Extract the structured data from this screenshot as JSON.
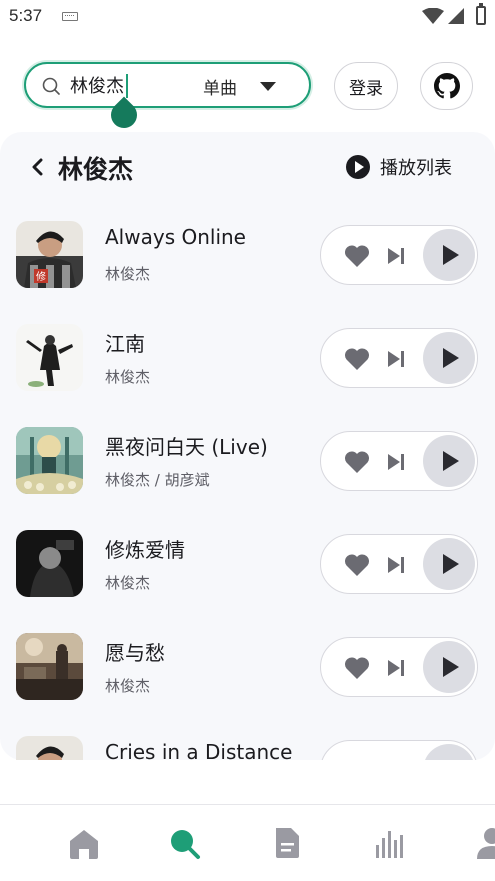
{
  "status_bar": {
    "time": "5:37"
  },
  "search": {
    "query": "林俊杰",
    "type_label": "单曲"
  },
  "header": {
    "login_label": "登录"
  },
  "page": {
    "title": "林俊杰",
    "playlist_label": "播放列表"
  },
  "songs": [
    {
      "title": "Always Online",
      "artist": "林俊杰"
    },
    {
      "title": "江南",
      "artist": "林俊杰"
    },
    {
      "title": "黑夜问白天 (Live)",
      "artist": "林俊杰 / 胡彦斌"
    },
    {
      "title": "修炼爱情",
      "artist": "林俊杰"
    },
    {
      "title": "愿与愁",
      "artist": "林俊杰"
    },
    {
      "title": "Cries in a Distance",
      "artist": ""
    }
  ],
  "colors": {
    "accent": "#1e9e77",
    "accent_dark": "#157a5c",
    "nav_inactive": "#9a9aa2",
    "play_bg": "#dcdde3"
  },
  "nav": {
    "items": [
      "home-icon",
      "search-icon",
      "document-icon",
      "chart-icon",
      "profile-icon"
    ],
    "active": "search-icon"
  }
}
